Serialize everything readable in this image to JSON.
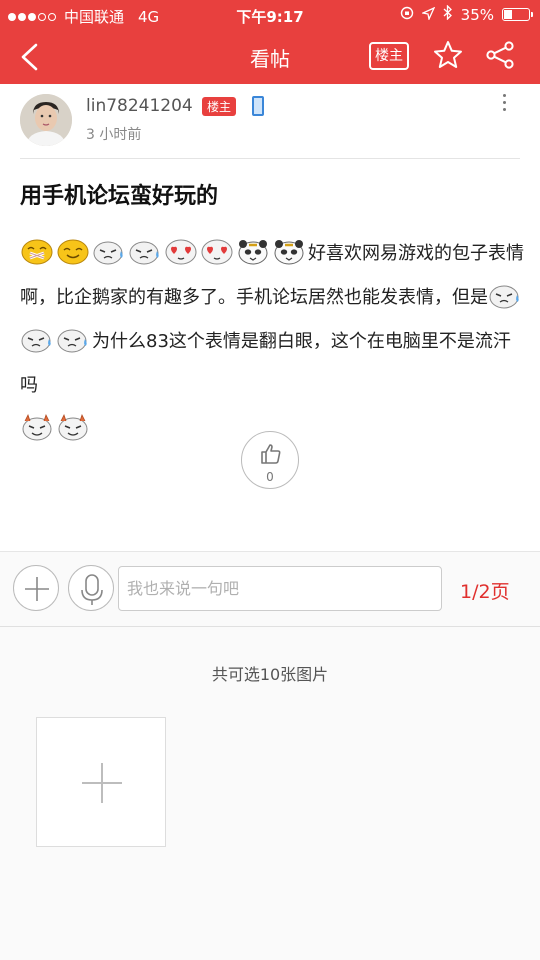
{
  "status_bar": {
    "carrier": "中国联通",
    "network": "4G",
    "time": "下午9:17",
    "battery_text": "35%",
    "battery_level": 0.35
  },
  "nav": {
    "title": "看帖",
    "author_only_label": "楼主"
  },
  "post": {
    "author": "lin78241204",
    "author_badge": "楼主",
    "time_ago": "3 小时前",
    "title": "用手机论坛蛮好玩的",
    "body": {
      "text_1": "好喜欢网易游戏的包子表情啊，比企鹅家的有趣多了。手机论坛居然也能发表情，但是",
      "text_2": "为什么83这个表情是翻白眼，这个在电脑里不是流汗吗",
      "emoji_group_1": [
        "shy-emoji",
        "happy-emoji",
        "sweat-emoji",
        "sweat-emoji",
        "heart-eyes-emoji",
        "heart-eyes-emoji",
        "panda-emoji",
        "panda-emoji"
      ],
      "emoji_group_2": [
        "sweat-emoji",
        "sweat-emoji",
        "sweat-emoji"
      ],
      "emoji_group_3": [
        "devil-emoji",
        "devil-emoji"
      ]
    },
    "likes": "0"
  },
  "comment_bar": {
    "placeholder": "我也来说一句吧",
    "page_indicator": "1/2页"
  },
  "image_picker": {
    "caption": "共可选10张图片"
  },
  "colors": {
    "brand_red": "#e8403e",
    "page_indicator_red": "#e0302e"
  }
}
